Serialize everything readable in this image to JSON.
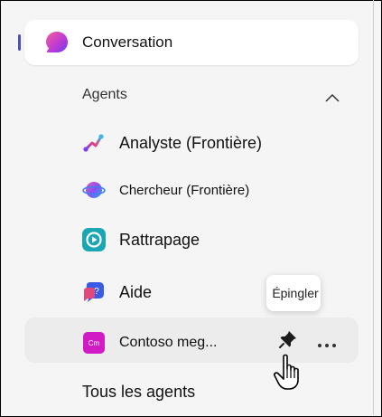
{
  "nav": {
    "conversation_label": "Conversation"
  },
  "agents_section": {
    "header_label": "Agents",
    "items": [
      {
        "label": "Analyste (Frontière)",
        "icon": "analyst-icon"
      },
      {
        "label": "Chercheur (Frontière)",
        "icon": "researcher-icon"
      },
      {
        "label": "Rattrapage",
        "icon": "catch-up-icon"
      },
      {
        "label": "Aide",
        "icon": "help-icon"
      },
      {
        "label": "Contoso meg...",
        "icon": "contoso-icon",
        "icon_text": "Cm"
      }
    ],
    "all_agents_label": "Tous les agents"
  },
  "tooltip": {
    "text": "Épingler"
  },
  "colors": {
    "accent": "#4f52b2",
    "contoso": "#d11bc5",
    "hover_bg": "#ececec",
    "panel_bg": "#f5f5f5"
  }
}
